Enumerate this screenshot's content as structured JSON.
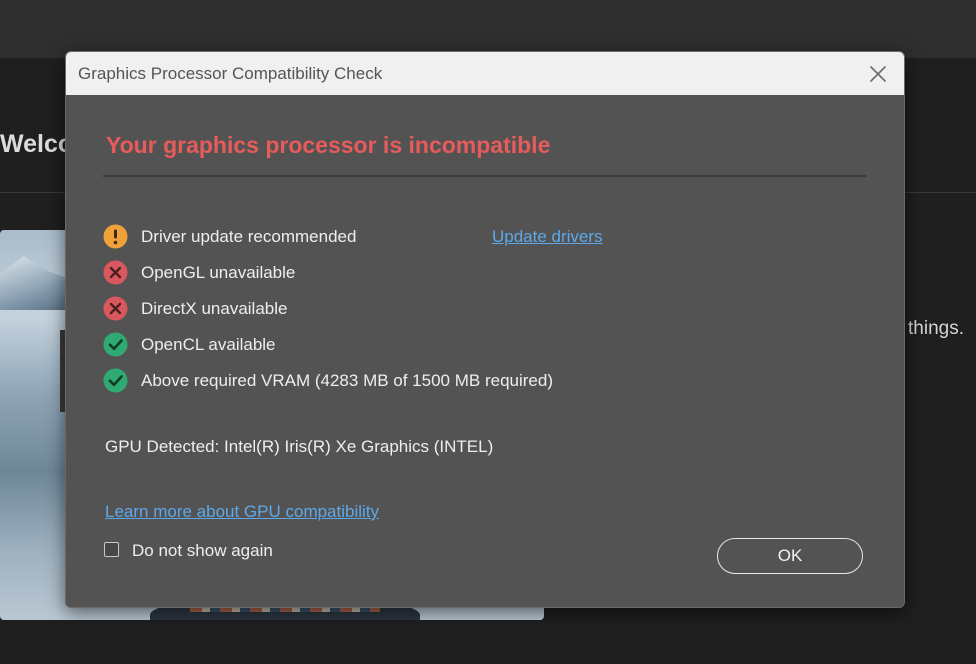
{
  "background": {
    "welcome_text": "Welco",
    "side_text": "things."
  },
  "dialog": {
    "title": "Graphics Processor Compatibility Check",
    "close_icon": "close-icon",
    "headline": "Your graphics processor is incompatible",
    "checks": [
      {
        "icon": "warning-icon",
        "status": "warning",
        "label": "Driver update recommended",
        "link": "Update drivers"
      },
      {
        "icon": "error-icon",
        "status": "error",
        "label": "OpenGL unavailable"
      },
      {
        "icon": "error-icon",
        "status": "error",
        "label": "DirectX unavailable"
      },
      {
        "icon": "success-icon",
        "status": "ok",
        "label": "OpenCL available"
      },
      {
        "icon": "success-icon",
        "status": "ok",
        "label": "Above required VRAM (4283 MB of 1500 MB required)"
      }
    ],
    "gpu_detected": "GPU Detected: Intel(R) Iris(R) Xe Graphics (INTEL)",
    "learn_more_link": "Learn more about GPU compatibility",
    "do_not_show_label": "Do not show again",
    "do_not_show_checked": false,
    "ok_label": "OK"
  },
  "colors": {
    "headline": "#e85b5b",
    "link": "#5fa8e8",
    "warning": "#f0a13a",
    "error": "#d9585d",
    "success": "#2eaa72"
  }
}
